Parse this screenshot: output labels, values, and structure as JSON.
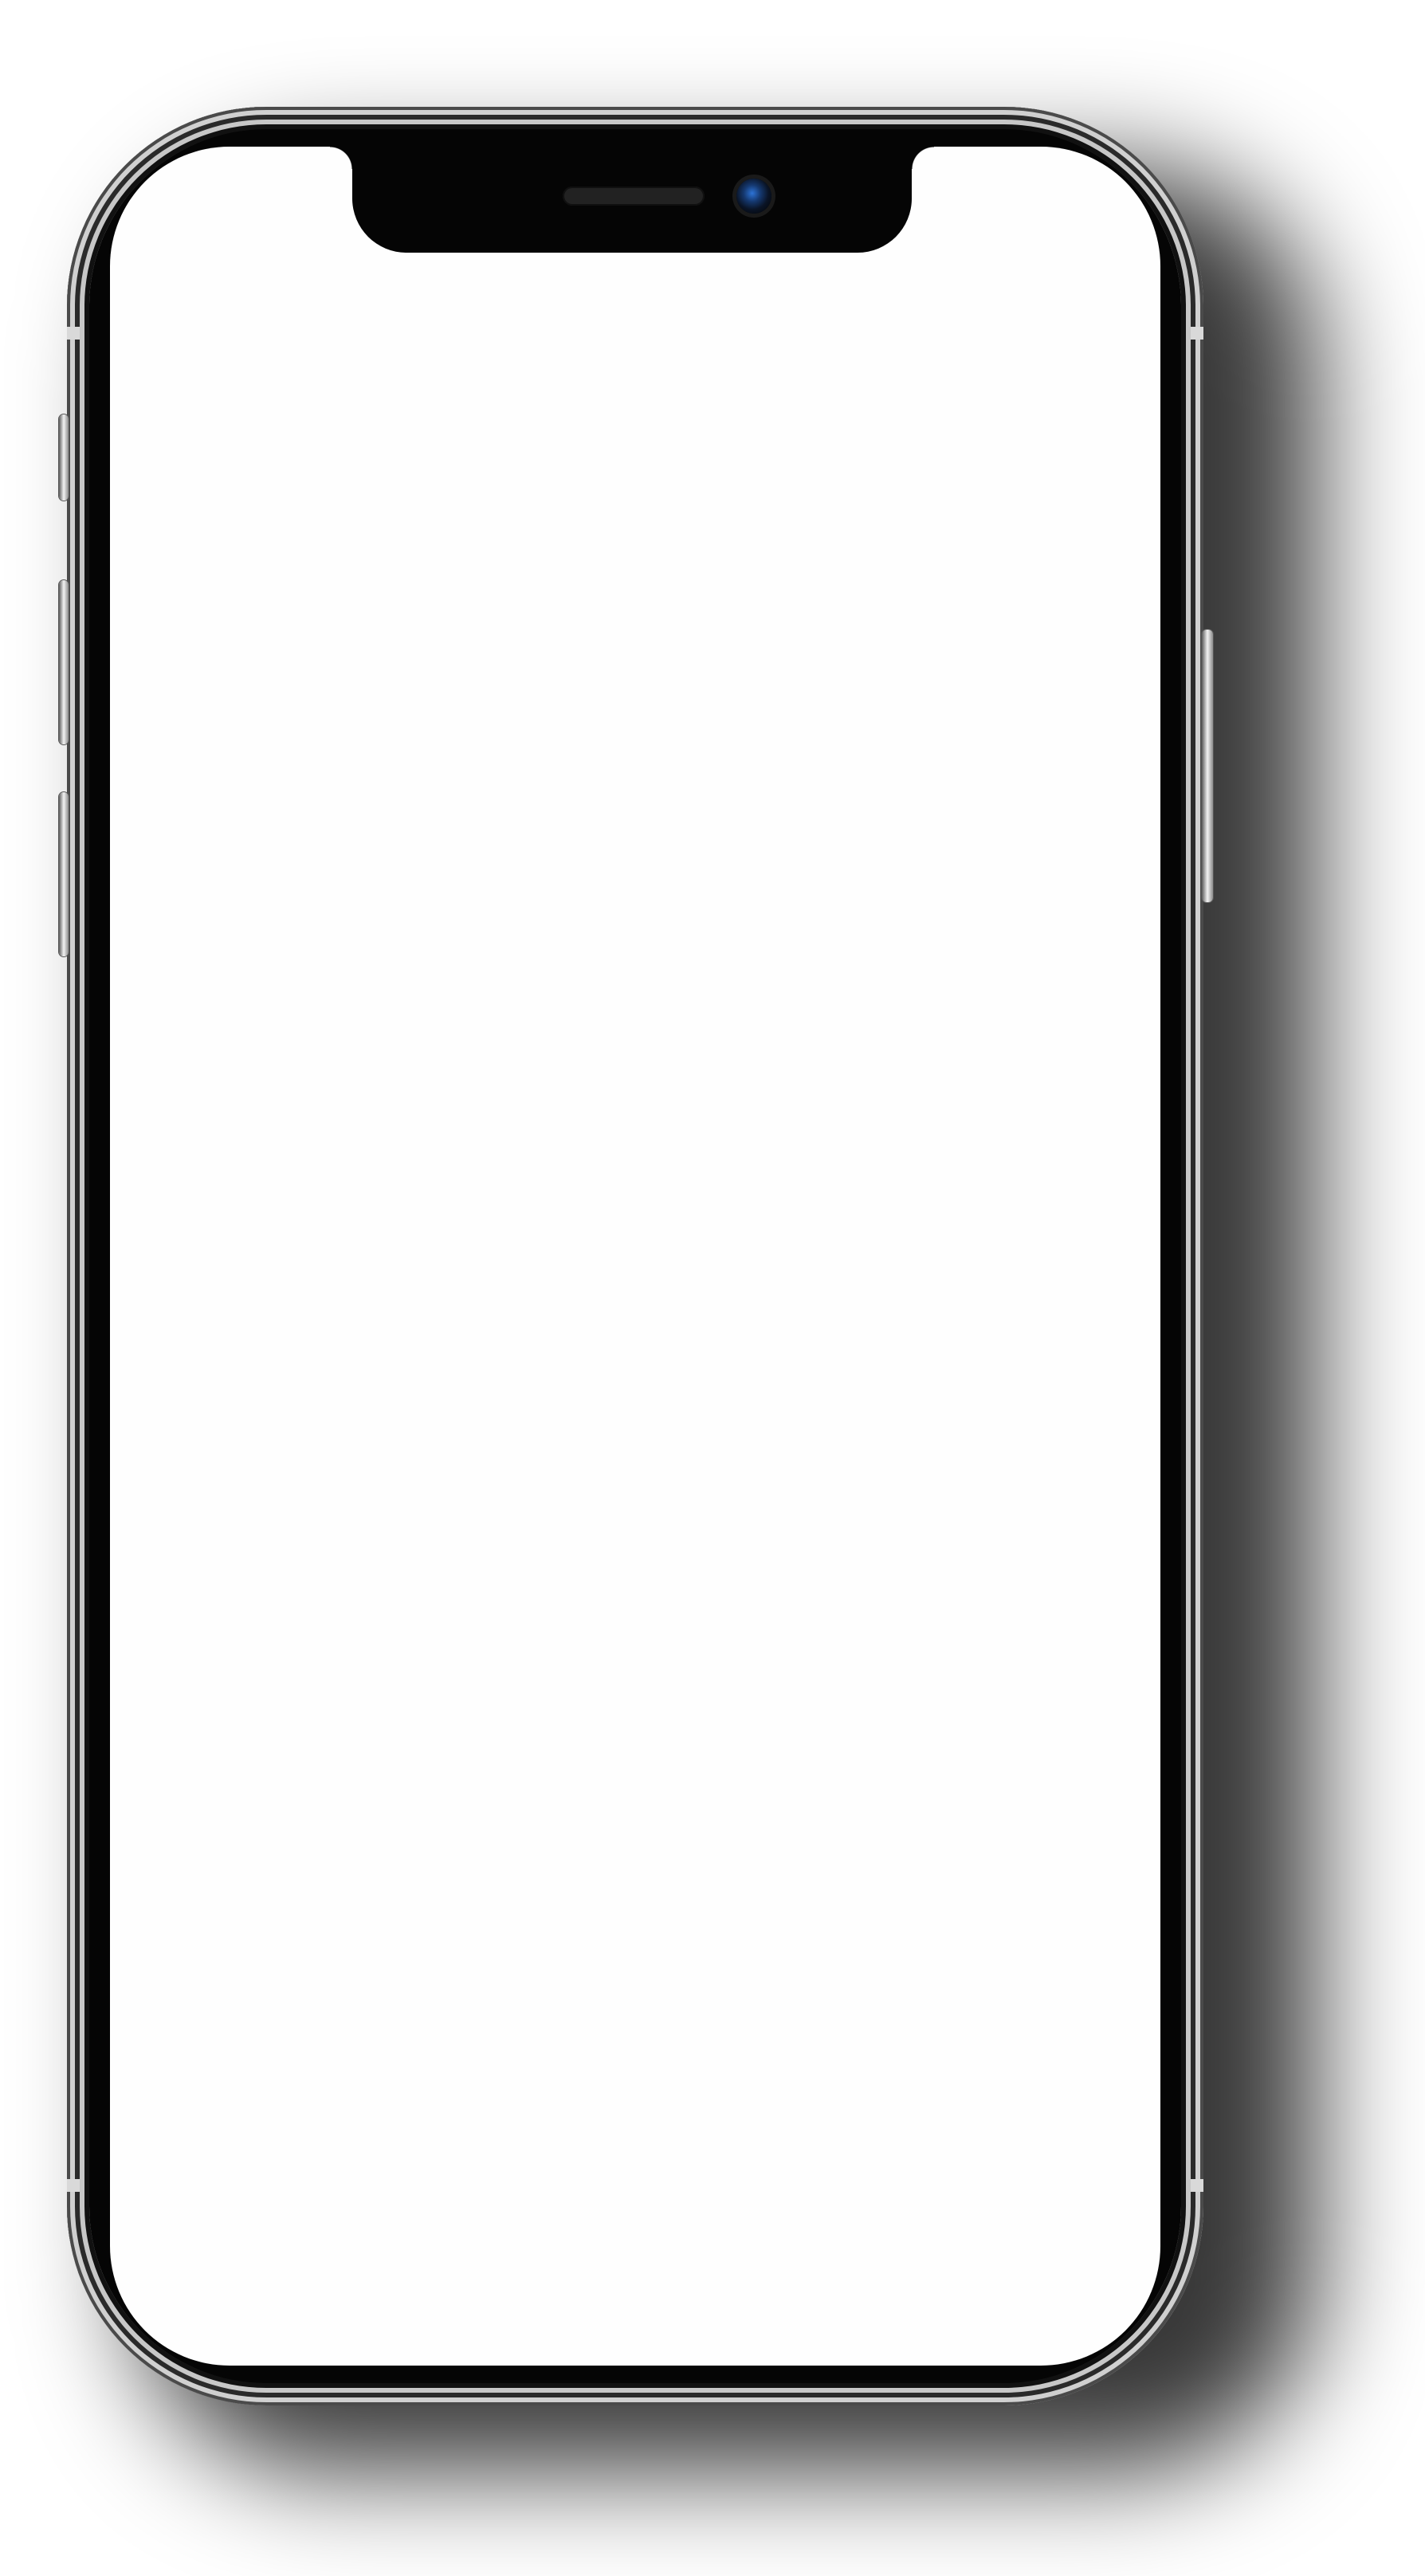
{
  "device": {
    "type": "smartphone",
    "screen_state": "blank"
  },
  "colors": {
    "screen": "#fefefe",
    "frame_dark": "#050505",
    "frame_metal": "#d0d0d0",
    "camera_lens": "#2d73d6"
  }
}
